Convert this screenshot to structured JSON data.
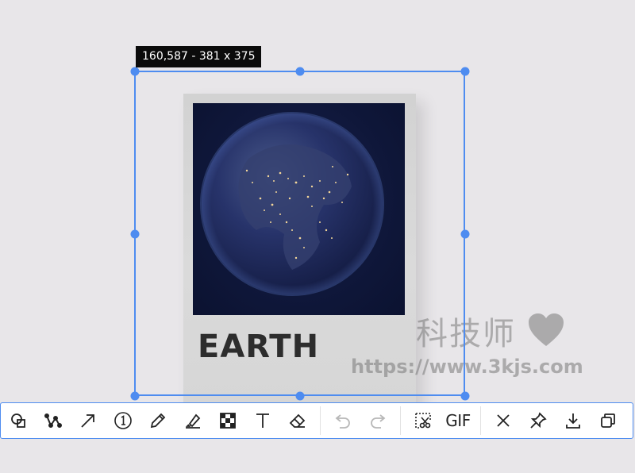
{
  "selection": {
    "info": "160,587 - 381 x 375"
  },
  "card": {
    "title": "EARTH"
  },
  "watermark": {
    "text_cn": "科技师",
    "url": "https://www.3kjs.com"
  },
  "toolbar": {
    "tools": [
      {
        "name": "shape-icon",
        "label": "Shape"
      },
      {
        "name": "polyline-icon",
        "label": "Polyline"
      },
      {
        "name": "arrow-icon",
        "label": "Arrow"
      },
      {
        "name": "number-icon",
        "label": "1"
      },
      {
        "name": "pencil-icon",
        "label": "Pencil"
      },
      {
        "name": "highlighter-icon",
        "label": "Highlighter"
      },
      {
        "name": "mosaic-icon",
        "label": "Mosaic"
      },
      {
        "name": "text-icon",
        "label": "T"
      },
      {
        "name": "eraser-icon",
        "label": "Eraser"
      }
    ],
    "gif_label": "GIF",
    "accent_color": "#4e8cf0"
  }
}
